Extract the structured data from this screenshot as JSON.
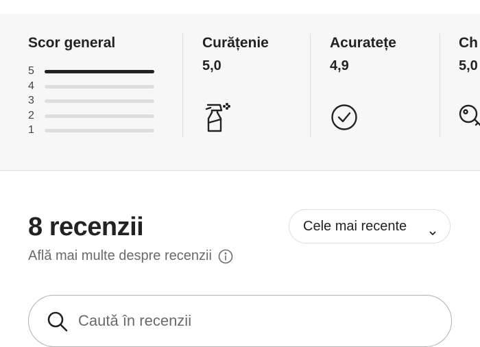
{
  "ratings": {
    "overall_title": "Scor general",
    "distribution": [
      {
        "stars": "5",
        "fraction": 1.0
      },
      {
        "stars": "4",
        "fraction": 0.0
      },
      {
        "stars": "3",
        "fraction": 0.0
      },
      {
        "stars": "2",
        "fraction": 0.0
      },
      {
        "stars": "1",
        "fraction": 0.0
      }
    ],
    "categories": [
      {
        "label": "Curățenie",
        "value": "5,0",
        "icon": "spray-bottle-icon"
      },
      {
        "label": "Acuratețe",
        "value": "4,9",
        "icon": "check-circle-icon"
      },
      {
        "label": "Ch",
        "value": "5,0",
        "icon": "key-icon"
      }
    ]
  },
  "reviews": {
    "count_label": "8 recenzii",
    "learn_more": "Află mai multe despre recenzii",
    "sort_label": "Cele mai recente",
    "search_placeholder": "Caută în recenzii"
  },
  "colors": {
    "band_background": "#f7f7f7",
    "bar_filled": "#222222",
    "bar_empty": "#dddddd",
    "muted_text": "#6a6a6a"
  }
}
